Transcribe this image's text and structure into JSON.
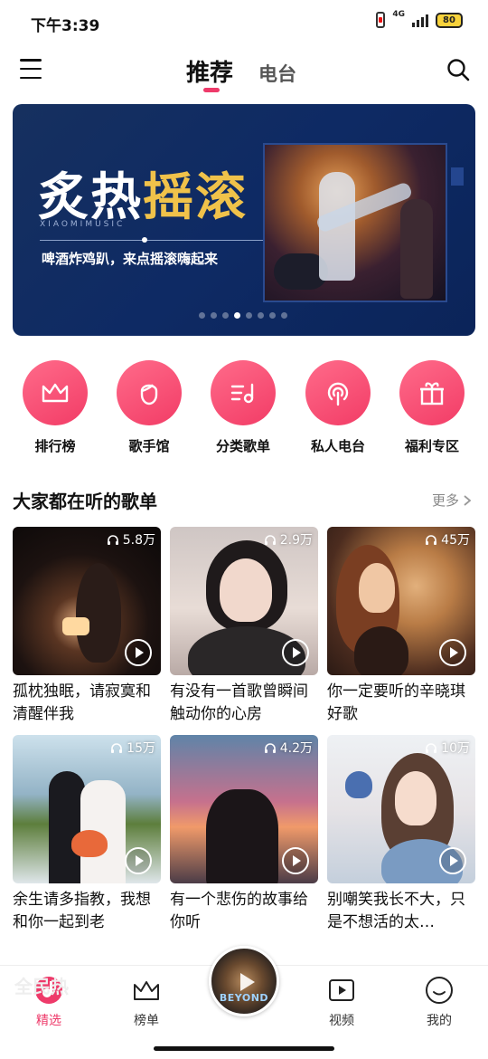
{
  "status_bar": {
    "time": "下午3:39",
    "network": "4G",
    "battery": "80"
  },
  "top_nav": {
    "tabs": [
      {
        "label": "推荐",
        "active": true
      },
      {
        "label": "电台",
        "active": false
      }
    ],
    "menu_icon": "menu-icon",
    "search_icon": "search-icon"
  },
  "banner": {
    "title_part1": "炙热",
    "title_part2": "摇滚",
    "subtitle_en": "XIAOMIMUSIC",
    "subtitle": "啤酒炸鸡趴，来点摇滚嗨起来",
    "page_count": 8,
    "active_page": 4
  },
  "quick_entries": [
    {
      "label": "排行榜",
      "icon": "crown-icon"
    },
    {
      "label": "歌手馆",
      "icon": "singer-icon"
    },
    {
      "label": "分类歌单",
      "icon": "category-playlist-icon"
    },
    {
      "label": "私人电台",
      "icon": "radio-icon"
    },
    {
      "label": "福利专区",
      "icon": "gift-icon"
    }
  ],
  "section": {
    "title": "大家都在听的歌单",
    "more": "更多"
  },
  "playlists": [
    {
      "title": "孤枕独眠，请寂寞和清醒伴我",
      "plays": "5.8万"
    },
    {
      "title": "有没有一首歌曾瞬间触动你的心房",
      "plays": "2.9万"
    },
    {
      "title": "你一定要听的辛晓琪好歌",
      "plays": "45万"
    },
    {
      "title": "余生请多指教，我想和你一起到老",
      "plays": "15万"
    },
    {
      "title": "有一个悲伤的故事给你听",
      "plays": "4.2万"
    },
    {
      "title": "别嘲笑我长不大，只是不想活的太…",
      "plays": "10万"
    }
  ],
  "next_section_hint": "全民热",
  "now_playing": {
    "cover_text": "BEYOND"
  },
  "bottom_nav": [
    {
      "label": "精选",
      "icon": "featured-icon",
      "active": true
    },
    {
      "label": "榜单",
      "icon": "chart-crown-icon",
      "active": false
    },
    {
      "label": "视频",
      "icon": "video-icon",
      "active": false
    },
    {
      "label": "我的",
      "icon": "profile-icon",
      "active": false
    }
  ],
  "colors": {
    "accent": "#ee3a6a",
    "banner_bg": "#0e2a64"
  }
}
